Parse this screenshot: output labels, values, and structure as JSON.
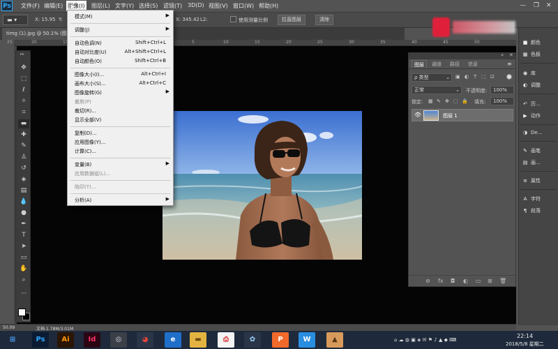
{
  "app": {
    "logo": "Ps"
  },
  "menubar": {
    "items": [
      "文件(F)",
      "编辑(E)",
      "图像(I)",
      "图层(L)",
      "文字(Y)",
      "选择(S)",
      "滤镜(T)",
      "3D(D)",
      "视图(V)",
      "窗口(W)",
      "帮助(H)"
    ],
    "active_index": 2
  },
  "options_bar": {
    "x": "X: 15.95",
    "y": "Y:",
    "partial": "X: 345.42",
    "l2": "L2:",
    "use_scale": "使用测量比例",
    "straighten": "拉直图层",
    "clear": "清除"
  },
  "document": {
    "tab_title": "timg (1).jpg @ 50.1% (图层 1..."
  },
  "ruler": {
    "h_ticks": [
      "25",
      "20",
      "15",
      "10",
      "5",
      "0",
      "5",
      "10",
      "15",
      "20",
      "25",
      "30",
      "35",
      "40",
      "45",
      "50"
    ]
  },
  "image_menu": {
    "items": [
      {
        "label": "模式(M)",
        "shortcut": "",
        "submenu": true,
        "disabled": false
      },
      {
        "label": "调整(J)",
        "shortcut": "",
        "submenu": true,
        "disabled": false
      },
      {
        "label": "自动色调(N)",
        "shortcut": "Shift+Ctrl+L",
        "submenu": false,
        "disabled": false
      },
      {
        "label": "自动对比度(U)",
        "shortcut": "Alt+Shift+Ctrl+L",
        "submenu": false,
        "disabled": false
      },
      {
        "label": "自动颜色(O)",
        "shortcut": "Shift+Ctrl+B",
        "submenu": false,
        "disabled": false
      },
      {
        "label": "图像大小(I)...",
        "shortcut": "Alt+Ctrl+I",
        "submenu": false,
        "disabled": false
      },
      {
        "label": "画布大小(S)...",
        "shortcut": "Alt+Ctrl+C",
        "submenu": false,
        "disabled": false
      },
      {
        "label": "图像旋转(G)",
        "shortcut": "",
        "submenu": true,
        "disabled": false
      },
      {
        "label": "裁剪(P)",
        "shortcut": "",
        "submenu": false,
        "disabled": true
      },
      {
        "label": "裁切(R)...",
        "shortcut": "",
        "submenu": false,
        "disabled": false
      },
      {
        "label": "显示全部(V)",
        "shortcut": "",
        "submenu": false,
        "disabled": false
      },
      {
        "label": "复制(D)...",
        "shortcut": "",
        "submenu": false,
        "disabled": false
      },
      {
        "label": "应用图像(Y)...",
        "shortcut": "",
        "submenu": false,
        "disabled": false
      },
      {
        "label": "计算(C)...",
        "shortcut": "",
        "submenu": false,
        "disabled": false
      },
      {
        "label": "变量(B)",
        "shortcut": "",
        "submenu": true,
        "disabled": false
      },
      {
        "label": "应用数据组(L)...",
        "shortcut": "",
        "submenu": false,
        "disabled": true
      },
      {
        "label": "陷印(T)...",
        "shortcut": "",
        "submenu": false,
        "disabled": true
      },
      {
        "label": "分析(A)",
        "shortcut": "",
        "submenu": true,
        "disabled": false
      }
    ]
  },
  "layers_panel": {
    "tabs": [
      "图层",
      "通道",
      "路径",
      "信息"
    ],
    "kind_filter": "ρ 类型",
    "blend_mode": "正常",
    "opacity_label": "不透明度:",
    "opacity_value": "100%",
    "lock_label": "锁定:",
    "fill_label": "填充:",
    "fill_value": "100%",
    "layer_name": "图层 1",
    "footer_icons": [
      "⊖",
      "fx",
      "◘",
      "◐",
      "▭",
      "⊞",
      "🗑"
    ]
  },
  "right_dock": {
    "groups": [
      [
        {
          "icon": "■",
          "label": "颜色"
        },
        {
          "icon": "▦",
          "label": "色板"
        }
      ],
      [
        {
          "icon": "◉",
          "label": "库"
        },
        {
          "icon": "◐",
          "label": "调整"
        }
      ],
      [
        {
          "icon": "↶",
          "label": "历..."
        },
        {
          "icon": "▶",
          "label": "动作"
        }
      ],
      [
        {
          "icon": "◑",
          "label": "De..."
        }
      ],
      [
        {
          "icon": "✎",
          "label": "画笔"
        },
        {
          "icon": "▤",
          "label": "画..."
        }
      ],
      [
        {
          "icon": "≡",
          "label": "属性"
        }
      ],
      [
        {
          "icon": "A",
          "label": "字符"
        },
        {
          "icon": "¶",
          "label": "段落"
        }
      ]
    ]
  },
  "status_bar": {
    "zoom": "50.09",
    "doc": "文档:1.78M/3.01M"
  },
  "taskbar": {
    "apps": [
      {
        "name": "windows-start",
        "glyph": "⊞",
        "bg": "#1e2a3b",
        "fg": "#4fa3ff"
      },
      {
        "name": "photoshop",
        "glyph": "Ps",
        "bg": "#0b1b33",
        "fg": "#31a8ff"
      },
      {
        "name": "illustrator",
        "glyph": "Ai",
        "bg": "#2b1505",
        "fg": "#ff9a00"
      },
      {
        "name": "indesign",
        "glyph": "Id",
        "bg": "#2a0615",
        "fg": "#ff3366"
      },
      {
        "name": "media-player",
        "glyph": "◎",
        "bg": "#3a3f48",
        "fg": "#dddddd"
      },
      {
        "name": "chrome",
        "glyph": "◕",
        "bg": "#2a3548",
        "fg": "#e8453c"
      },
      {
        "name": "browser",
        "glyph": "e",
        "bg": "#1f6fc9",
        "fg": "#ffffff"
      },
      {
        "name": "file-explorer",
        "glyph": "▬",
        "bg": "#e3b341",
        "fg": "#6b4a10"
      },
      {
        "name": "pdf-reader",
        "glyph": "⎙",
        "bg": "#f3f3f3",
        "fg": "#d9262b"
      },
      {
        "name": "network-tool",
        "glyph": "✿",
        "bg": "#2a3548",
        "fg": "#9fd3ff"
      },
      {
        "name": "wps-presentation",
        "glyph": "P",
        "bg": "#f06a2b",
        "fg": "#ffffff"
      },
      {
        "name": "wps-writer",
        "glyph": "W",
        "bg": "#2a8ee0",
        "fg": "#ffffff"
      },
      {
        "name": "image-viewer",
        "glyph": "▲",
        "bg": "#d89a5a",
        "fg": "#5a3a1a"
      }
    ],
    "time": "22:14",
    "date": "2018/5/8 星期二"
  }
}
